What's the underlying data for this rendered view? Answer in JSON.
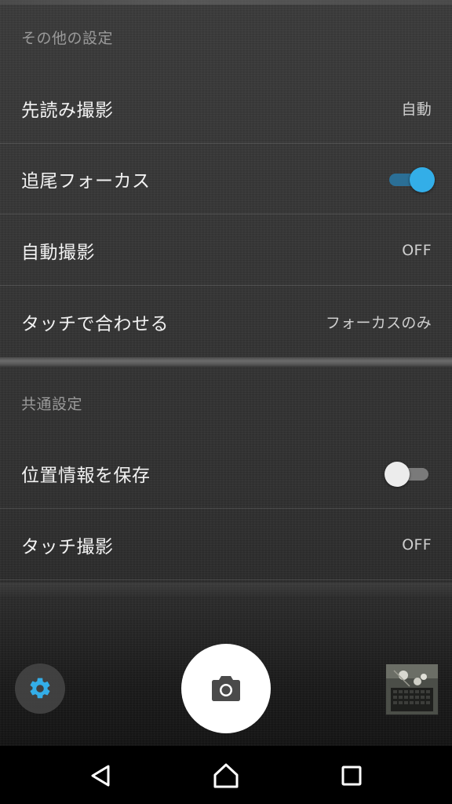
{
  "sections": {
    "other": {
      "header": "その他の設定",
      "items": [
        {
          "label": "先読み撮影",
          "value": "自動"
        },
        {
          "label": "追尾フォーカス",
          "toggle": "on"
        },
        {
          "label": "自動撮影",
          "value": "OFF"
        },
        {
          "label": "タッチで合わせる",
          "value": "フォーカスのみ"
        }
      ]
    },
    "common": {
      "header": "共通設定",
      "items": [
        {
          "label": "位置情報を保存",
          "toggle": "off"
        },
        {
          "label": "タッチ撮影",
          "value": "OFF"
        }
      ]
    }
  },
  "controls": {
    "settings_icon": "gear-icon",
    "shutter_icon": "camera-icon",
    "gallery": "gallery-thumbnail"
  },
  "nav": {
    "back_icon": "back-triangle-icon",
    "home_icon": "home-icon",
    "recents_icon": "recents-square-icon"
  },
  "colors": {
    "accent": "#33aee8",
    "toggle_on_track": "#2b6f96"
  }
}
